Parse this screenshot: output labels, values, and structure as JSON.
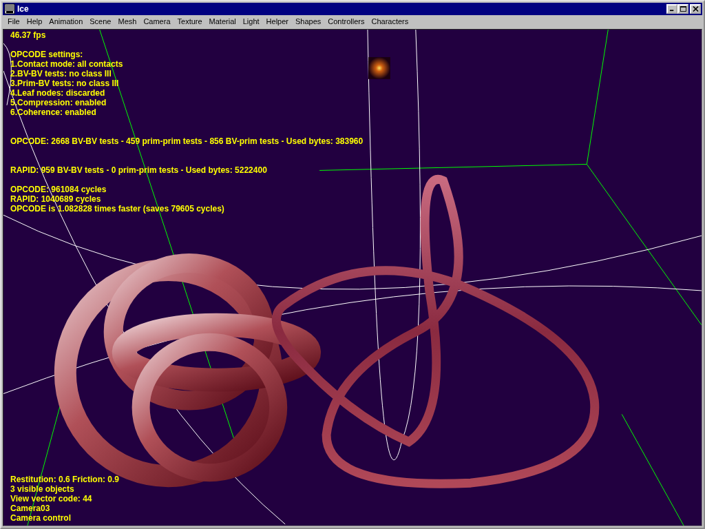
{
  "window": {
    "title": "Ice"
  },
  "menu": [
    "File",
    "Help",
    "Animation",
    "Scene",
    "Mesh",
    "Camera",
    "Texture",
    "Material",
    "Light",
    "Helper",
    "Shapes",
    "Controllers",
    "Characters"
  ],
  "viewport": {
    "fps": "46.37 fps",
    "settings_title": "OPCODE settings:",
    "settings": [
      "1.Contact mode: all contacts",
      "2.BV-BV tests: no class III",
      "3.Prim-BV tests: no class III",
      "4.Leaf nodes: discarded",
      "5.Compression: enabled",
      "6.Coherence: enabled"
    ],
    "opcode_stats": "OPCODE: 2668 BV-BV tests - 459 prim-prim tests - 856 BV-prim tests - Used bytes: 383960",
    "rapid_stats": "RAPID: 959 BV-BV tests - 0 prim-prim tests - Used bytes: 5222400",
    "timing": [
      "OPCODE: 961084 cycles",
      "RAPID: 1040689 cycles",
      "OPCODE is 1.082828 times faster (saves 79605 cycles)"
    ],
    "status": [
      "Restitution: 0.6  Friction: 0.9",
      "3 visible objects",
      "View vector code: 44",
      "Camera03",
      "Camera control"
    ]
  }
}
